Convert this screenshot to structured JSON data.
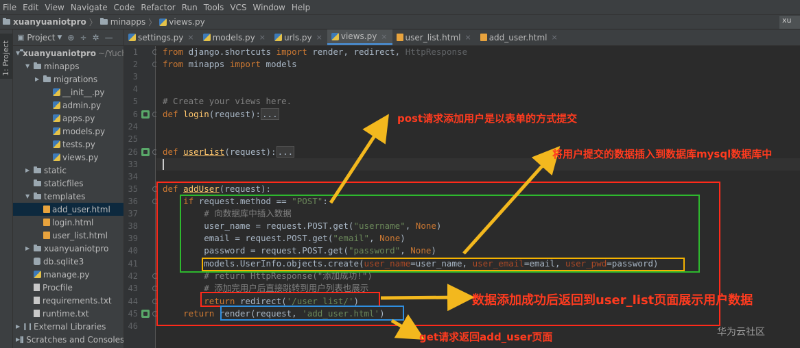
{
  "menu": [
    "File",
    "Edit",
    "View",
    "Navigate",
    "Code",
    "Refactor",
    "Run",
    "Tools",
    "VCS",
    "Window",
    "Help"
  ],
  "nav": {
    "project": "xuanyuaniotpro",
    "folder": "minapps",
    "file": "views.py",
    "right_label": "xu"
  },
  "stripe_label": "1: Project",
  "project_panel": {
    "header_label": "Project",
    "tree": [
      {
        "label": "xuanyuaniotpro",
        "dim": "~/Yuchu",
        "type": "folder",
        "open": true,
        "indent": 0
      },
      {
        "label": "minapps",
        "type": "folder",
        "open": true,
        "indent": 1
      },
      {
        "label": "migrations",
        "type": "folder",
        "open": false,
        "indent": 2
      },
      {
        "label": "__init__.py",
        "type": "py",
        "indent": 3
      },
      {
        "label": "admin.py",
        "type": "py",
        "indent": 3
      },
      {
        "label": "apps.py",
        "type": "py",
        "indent": 3
      },
      {
        "label": "models.py",
        "type": "py",
        "indent": 3
      },
      {
        "label": "tests.py",
        "type": "py",
        "indent": 3
      },
      {
        "label": "views.py",
        "type": "py",
        "indent": 3
      },
      {
        "label": "static",
        "type": "folder",
        "open": false,
        "indent": 1
      },
      {
        "label": "staticfiles",
        "type": "folder",
        "indent": 1
      },
      {
        "label": "templates",
        "type": "folder",
        "open": true,
        "indent": 1
      },
      {
        "label": "add_user.html",
        "type": "html",
        "indent": 2,
        "selected": true
      },
      {
        "label": "login.html",
        "type": "html",
        "indent": 2
      },
      {
        "label": "user_list.html",
        "type": "html",
        "indent": 2
      },
      {
        "label": "xuanyuaniotpro",
        "type": "folder",
        "open": false,
        "indent": 1
      },
      {
        "label": "db.sqlite3",
        "type": "db",
        "indent": 1
      },
      {
        "label": "manage.py",
        "type": "py",
        "indent": 1
      },
      {
        "label": "Procfile",
        "type": "txt",
        "indent": 1
      },
      {
        "label": "requirements.txt",
        "type": "txt",
        "indent": 1
      },
      {
        "label": "runtime.txt",
        "type": "txt",
        "indent": 1
      },
      {
        "label": "External Libraries",
        "type": "lib",
        "open": false,
        "indent": 0
      },
      {
        "label": "Scratches and Consoles",
        "type": "lib",
        "open": false,
        "indent": 0
      }
    ]
  },
  "tabs": [
    {
      "label": "settings.py",
      "type": "py"
    },
    {
      "label": "models.py",
      "type": "py"
    },
    {
      "label": "urls.py",
      "type": "py"
    },
    {
      "label": "views.py",
      "type": "py",
      "active": true
    },
    {
      "label": "user_list.html",
      "type": "html"
    },
    {
      "label": "add_user.html",
      "type": "html"
    }
  ],
  "line_numbers": [
    "1",
    "2",
    "3",
    "4",
    "5",
    "6",
    "24",
    "25",
    "26",
    "33",
    "34",
    "35",
    "36",
    "37",
    "38",
    "39",
    "40",
    "41",
    "42",
    "43",
    "44",
    "45",
    "46"
  ],
  "code": {
    "l1_from": "from",
    "l1_mod": " django.shortcuts ",
    "l1_import": "import",
    "l1_rest": " render, redirect, ",
    "l1_gray": "HttpResponse",
    "l2_from": "from",
    "l2_mod": " minapps ",
    "l2_import": "import",
    "l2_rest": " models",
    "l5": "# Create your views here.",
    "l6_def": "def ",
    "l6_fn": "login",
    "l6_args": "(request):",
    "l6_fold": "...",
    "l26_def": "def ",
    "l26_fn": "userList",
    "l26_args": "(request):",
    "l26_fold": "...",
    "l35_def": "def ",
    "l35_fn": "addUser",
    "l35_args": "(request):",
    "l36_if": "if",
    "l36_cond": " request.method == ",
    "l36_str": "\"POST\"",
    "l36_colon": ":",
    "l37": "# 向数据库中插入数据",
    "l38_a": "user_name = request.POST.get(",
    "l38_s": "\"username\"",
    "l38_b": ", ",
    "l38_n": "None",
    "l38_c": ")",
    "l39_a": "email = request.POST.get(",
    "l39_s": "\"email\"",
    "l39_b": ", ",
    "l39_n": "None",
    "l39_c": ")",
    "l40_a": "password = request.POST.get(",
    "l40_s": "\"password\"",
    "l40_b": ", ",
    "l40_n": "None",
    "l40_c": ")",
    "l41_a": "models.UserInfo.objects.create(",
    "l41_p1": "user_name",
    "l41_v1": "=user_name, ",
    "l41_p2": "user_email",
    "l41_v2": "=email, ",
    "l41_p3": "user_pwd",
    "l41_v3": "=password)",
    "l42": "# return HttpResponse(\"添加成功!\")",
    "l43": "# 添加完用户后直接跳转到用户列表也展示",
    "l44_ret": "return",
    "l44_a": " redirect(",
    "l44_s": "'/user_list/'",
    "l44_b": ")",
    "l45_ret": "return",
    "l45_a": " render(request, ",
    "l45_s": "'add_user.html'",
    "l45_b": ")"
  },
  "annotations": {
    "post_form": "post请求添加用户是以表单的方式提交",
    "insert_mysql": "将用户提交的数据插入到数据库mysql数据库中",
    "redirect_list": "数据添加成功后返回到user_list页面展示用户数据",
    "get_return": "get请求返回add_user页面"
  },
  "colors": {
    "red_box": "#ff2a1a",
    "green_box": "#2eb82e",
    "orange_box": "#f5b300",
    "blue_box": "#2f8fe0",
    "arrow": "#f3b81e",
    "annotation_text": "#ff3b1f"
  },
  "watermark": "华为云社区"
}
